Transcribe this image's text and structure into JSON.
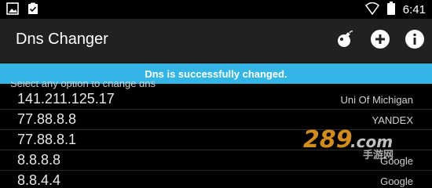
{
  "status_bar": {
    "time": "6:41",
    "icons": [
      "image-icon",
      "clipboard-check-icon",
      "wifi-icon",
      "battery-icon"
    ]
  },
  "app_bar": {
    "title": "Dns Changer",
    "actions": [
      "bomb-icon",
      "add-circle-icon",
      "info-icon"
    ]
  },
  "toast": {
    "message": "Dns is successfully changed."
  },
  "hint_text": "Select any option to change dns",
  "dns_list": [
    {
      "ip": "141.211.125.17",
      "name": "Uni Of Michigan"
    },
    {
      "ip": "77.88.8.8",
      "name": "YANDEX"
    },
    {
      "ip": "77.88.8.1",
      "name": ""
    },
    {
      "ip": "8.8.8.8",
      "name": "Google"
    },
    {
      "ip": "8.8.4.4",
      "name": "Google"
    }
  ],
  "watermark": {
    "brand": "289.com",
    "subtitle": "手游网"
  },
  "colors": {
    "toast_bg": "#33b5e5",
    "app_bar_bg": "#212121",
    "background": "#000000"
  }
}
